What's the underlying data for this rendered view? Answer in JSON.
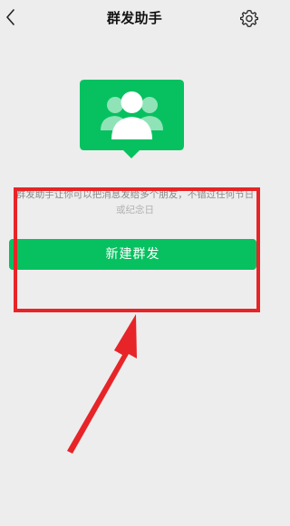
{
  "header": {
    "title": "群发助手",
    "back_icon": "chevron-left-icon",
    "settings_icon": "gear-icon"
  },
  "hero": {
    "icon": "group-contacts-icon",
    "color": "#07c160"
  },
  "description": {
    "line1": "群发助手让你可以把消息发给多个朋友，不错过任何节日",
    "line2": "或纪念日"
  },
  "primary_button": {
    "label": "新建群发",
    "color": "#07c160"
  },
  "annotation": {
    "color": "#e72428"
  }
}
